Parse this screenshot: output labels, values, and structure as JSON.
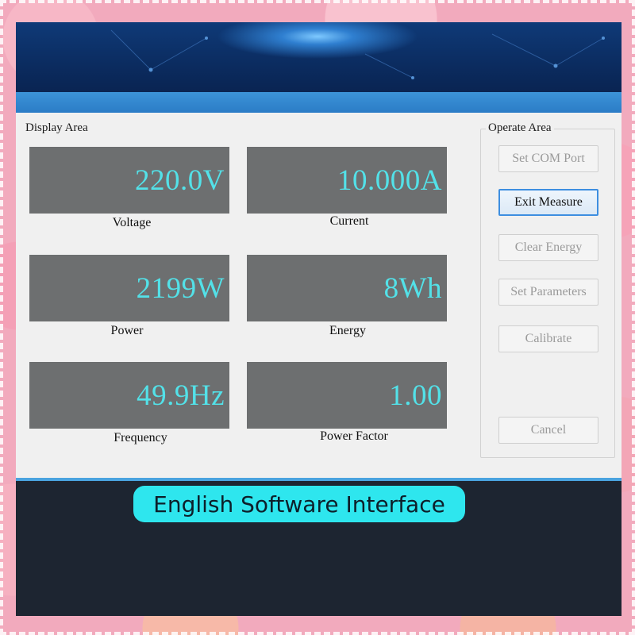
{
  "display_area": {
    "title": "Display Area",
    "meters": [
      {
        "value": "220.0V",
        "label": "Voltage"
      },
      {
        "value": "10.000A",
        "label": "Current"
      },
      {
        "value": "2199W",
        "label": "Power"
      },
      {
        "value": "8Wh",
        "label": "Energy"
      },
      {
        "value": "49.9Hz",
        "label": "Frequency"
      },
      {
        "value": "1.00",
        "label": "Power Factor"
      }
    ]
  },
  "operate_area": {
    "title": "Operate Area",
    "buttons": [
      {
        "label": "Set COM Port",
        "enabled": false
      },
      {
        "label": "Exit Measure",
        "enabled": true
      },
      {
        "label": "Clear Energy",
        "enabled": false
      },
      {
        "label": "Set Parameters",
        "enabled": false
      },
      {
        "label": "Calibrate",
        "enabled": false
      },
      {
        "label": "Cancel",
        "enabled": false
      }
    ]
  },
  "caption": "English Software Interface",
  "colors": {
    "meter_text": "#53e1e8",
    "meter_bg": "#6d6f70",
    "caption_bg": "#2ee6ee",
    "titlebar": "#2b7cc6"
  }
}
